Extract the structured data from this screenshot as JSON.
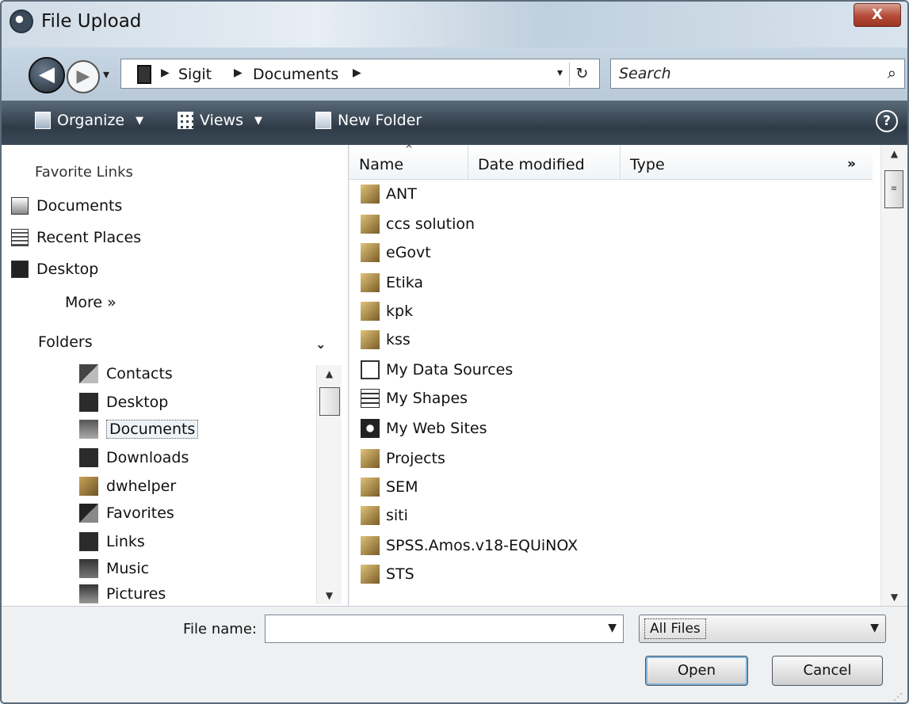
{
  "window": {
    "title": "File Upload",
    "close_label": "X"
  },
  "nav": {
    "back": "◀",
    "forward": "▶",
    "history": "▾"
  },
  "breadcrumb": [
    {
      "label": "Sigit"
    },
    {
      "label": "Documents"
    }
  ],
  "breadcrumb_sep": "▶",
  "address_dropdown": "▾",
  "refresh_icon": "↻",
  "search": {
    "placeholder": "Search",
    "icon": "⌕"
  },
  "toolbar": {
    "organize": "Organize",
    "views": "Views",
    "new_folder": "New Folder",
    "help": "?"
  },
  "nav_pane": {
    "favorite_links_title": "Favorite Links",
    "favorites": [
      {
        "label": "Documents",
        "icon": "documents-icon"
      },
      {
        "label": "Recent Places",
        "icon": "recent-places-icon"
      },
      {
        "label": "Desktop",
        "icon": "desktop-icon"
      }
    ],
    "more_label": "More  »",
    "folders_title": "Folders",
    "folders_collapse": "⌄",
    "folders": [
      {
        "label": "Contacts",
        "icon": "contacts-icon"
      },
      {
        "label": "Desktop",
        "icon": "desktop-folder-icon"
      },
      {
        "label": "Documents",
        "icon": "documents-folder-icon",
        "selected": true
      },
      {
        "label": "Downloads",
        "icon": "downloads-icon"
      },
      {
        "label": "dwhelper",
        "icon": "folder-icon"
      },
      {
        "label": "Favorites",
        "icon": "favorites-icon"
      },
      {
        "label": "Links",
        "icon": "links-icon"
      },
      {
        "label": "Music",
        "icon": "music-icon"
      },
      {
        "label": "Pictures",
        "icon": "pictures-icon"
      }
    ]
  },
  "file_list": {
    "columns": [
      "Name",
      "Date modified",
      "Type"
    ],
    "more_columns": "»",
    "items": [
      {
        "name": "ANT",
        "icon": "folder-icon"
      },
      {
        "name": "ccs solution",
        "icon": "folder-icon"
      },
      {
        "name": "eGovt",
        "icon": "folder-icon"
      },
      {
        "name": "Etika",
        "icon": "folder-icon"
      },
      {
        "name": "kpk",
        "icon": "folder-icon"
      },
      {
        "name": "kss",
        "icon": "folder-icon"
      },
      {
        "name": "My Data Sources",
        "icon": "data-sources-icon"
      },
      {
        "name": "My Shapes",
        "icon": "shapes-icon"
      },
      {
        "name": "My Web Sites",
        "icon": "web-sites-icon"
      },
      {
        "name": "Projects",
        "icon": "folder-icon"
      },
      {
        "name": "SEM",
        "icon": "folder-icon"
      },
      {
        "name": "siti",
        "icon": "folder-icon"
      },
      {
        "name": "SPSS.Amos.v18-EQUiNOX",
        "icon": "folder-icon"
      },
      {
        "name": "STS",
        "icon": "folder-icon"
      }
    ]
  },
  "bottom": {
    "file_name_label": "File name:",
    "file_name_value": "",
    "filter_value": "All Files",
    "open_label": "Open",
    "cancel_label": "Cancel"
  },
  "colors": {
    "toolbar": "#2f3c48",
    "folder": "#c9a25a",
    "accent": "#7fb2d8"
  }
}
